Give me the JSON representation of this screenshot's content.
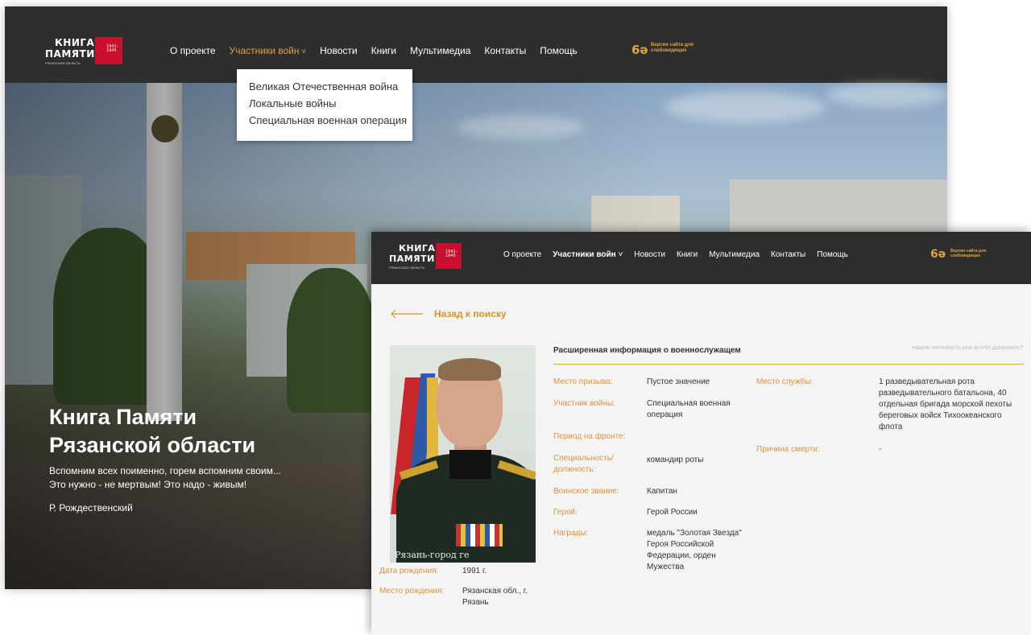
{
  "back_window": {
    "logo": {
      "line1": "КНИГА",
      "line2": "ПАМЯТИ",
      "region": "РЯЗАНСКАЯ ОБЛАСТЬ",
      "years": "1941-1945"
    },
    "nav": [
      {
        "label": "О проекте",
        "active": false
      },
      {
        "label": "Участники войн",
        "active": true,
        "has_dropdown": true
      },
      {
        "label": "Новости",
        "active": false
      },
      {
        "label": "Книги",
        "active": false
      },
      {
        "label": "Мультимедиа",
        "active": false
      },
      {
        "label": "Контакты",
        "active": false
      },
      {
        "label": "Помощь",
        "active": false
      }
    ],
    "accessibility": {
      "icon": "glasses-icon",
      "line1": "Версия сайта для",
      "line2": "слабовидящих"
    },
    "dropdown": [
      "Великая Отечественная война",
      "Локальные войны",
      "Специальная военная операция"
    ],
    "hero": {
      "title_line1": "Книга Памяти",
      "title_line2": "Рязанской области",
      "quote_line1": "Вспомним всех поименно, горем вспомним своим...",
      "quote_line2": "Это нужно - не мертвым! Это надо - живым!",
      "author": "Р. Рождественский"
    }
  },
  "front_window": {
    "nav": [
      {
        "label": "О проекте",
        "active": false
      },
      {
        "label": "Участники войн",
        "active": true,
        "has_dropdown": true
      },
      {
        "label": "Новости",
        "active": false
      },
      {
        "label": "Книги",
        "active": false
      },
      {
        "label": "Мультимедиа",
        "active": false
      },
      {
        "label": "Контакты",
        "active": false
      },
      {
        "label": "Помощь",
        "active": false
      }
    ],
    "back_link": "Назад к поиску",
    "photo_caption": "Рязань-город ге",
    "section_title": "Расширенная информация о военнослужащем",
    "error_link": "Нашли неточность или хотите дополнить?",
    "left_fields": [
      {
        "label": "Место призыва:",
        "value": "Пустое значение"
      },
      {
        "label": "Участник войны:",
        "value": "Специальная военная операция"
      },
      {
        "label": "Период на фронте:",
        "value": ""
      },
      {
        "label": "Специальность/ должность:",
        "value": "командир роты"
      },
      {
        "label": "Воинское звание:",
        "value": "Капитан"
      },
      {
        "label": "Герой:",
        "value": "Герой России"
      },
      {
        "label": "Награды:",
        "value": "медаль \"Золотая Звезда\" Героя Российской Федерации, орден Мужества"
      }
    ],
    "right_fields": [
      {
        "label": "Место службы:",
        "value": "1 разведывательная рота разведывательного батальона, 40 отдельная бригада морской пехоты береговых войск Тихоокеанского флота"
      },
      {
        "label": "Причина смерти:",
        "value": "-"
      }
    ],
    "bottom_fields": [
      {
        "label": "Дата рождения:",
        "value": "1991 г."
      },
      {
        "label": "Место рождения:",
        "value": "Рязанская обл., г. Рязань"
      }
    ]
  },
  "colors": {
    "topbar": "#2f2e2e",
    "accent": "#e0a33e",
    "logo_red": "#c8102e",
    "page_bg": "#f4f4f4"
  }
}
